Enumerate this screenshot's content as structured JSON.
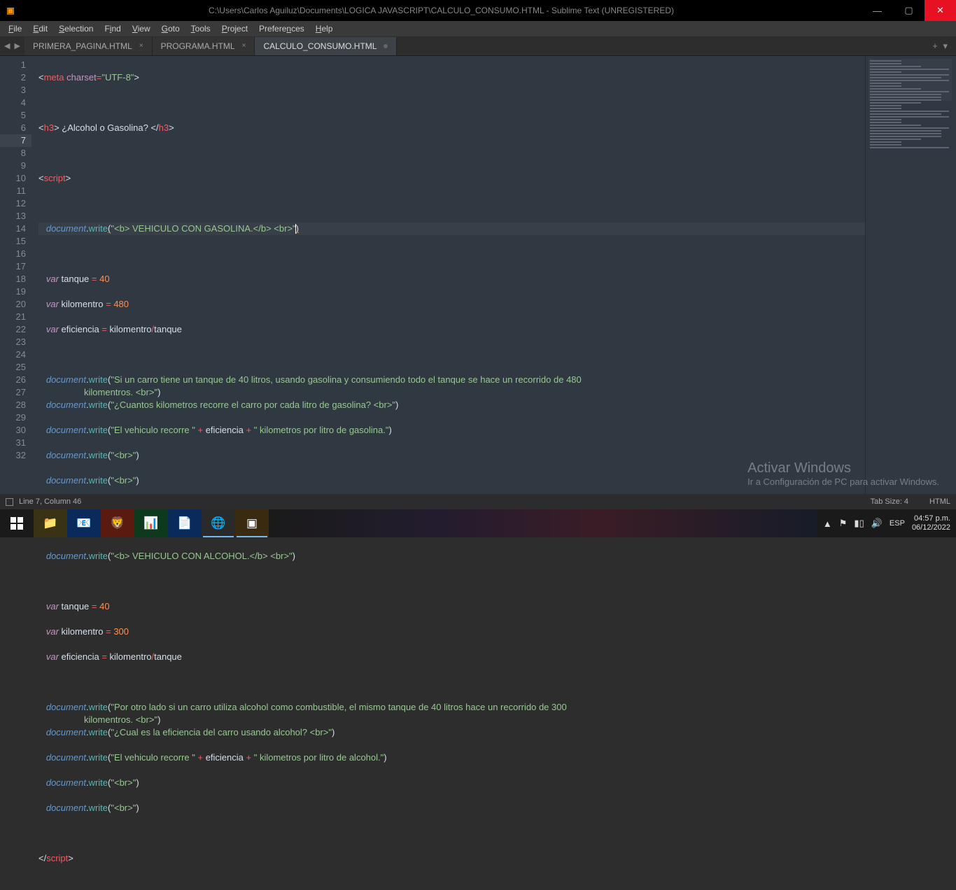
{
  "titlebar": {
    "path": "C:\\Users\\Carlos Aguiluz\\Documents\\LOGICA JAVASCRIPT\\CALCULO_CONSUMO.HTML - Sublime Text (UNREGISTERED)"
  },
  "menu": [
    "File",
    "Edit",
    "Selection",
    "Find",
    "View",
    "Goto",
    "Tools",
    "Project",
    "Preferences",
    "Help"
  ],
  "tabs": [
    {
      "label": "PRIMERA_PAGINA.HTML",
      "active": false
    },
    {
      "label": "PROGRAMA.HTML",
      "active": false
    },
    {
      "label": "CALCULO_CONSUMO.HTML",
      "active": true
    }
  ],
  "line_numbers": [
    "1",
    "2",
    "3",
    "4",
    "5",
    "6",
    "7",
    "8",
    "9",
    "10",
    "11",
    "12",
    "13",
    "14",
    "15",
    "16",
    "17",
    "18",
    "19",
    "20",
    "21",
    "22",
    "23",
    "24",
    "25",
    "26",
    "27",
    "28",
    "29",
    "30",
    "31",
    "32"
  ],
  "code": {
    "l1": {
      "pre": "<",
      "tag": "meta",
      "sp": " ",
      "attr": "charset",
      "eq": "=",
      "str": "\"UTF-8\"",
      "post": ">"
    },
    "l3": {
      "o1": "<",
      "t1": "h3",
      "c1": ">",
      "tx": " ¿Alcohol o Gasolina? ",
      "o2": "</",
      "t2": "h3",
      "c2": ">"
    },
    "l5": {
      "o": "<",
      "t": "script",
      "c": ">"
    },
    "l7": {
      "obj": "document",
      "dot": ".",
      "m": "write",
      "par": "(",
      "str": "\"<b> VEHICULO CON GASOLINA.</b> <br>\"",
      "par2": ")"
    },
    "l9": {
      "k": "var",
      "n": " tanque ",
      "eq": "=",
      "v": " 40"
    },
    "l10": {
      "k": "var",
      "n": " kilomentro ",
      "eq": "=",
      "v": " 480"
    },
    "l11": {
      "k": "var",
      "n": " eficiencia ",
      "eq": "=",
      "e": " kilomentro",
      "op": "/",
      "e2": "tanque"
    },
    "l13a": {
      "obj": "document",
      "dot": ".",
      "m": "write",
      "par": "(",
      "str": "\"Si un carro tiene un tanque de 40 litros, usando gasolina y consumiendo todo el tanque se hace un recorrido de 480 "
    },
    "l13b": {
      "str": "kilomentros. <br>\"",
      "par2": ")"
    },
    "l14": {
      "obj": "document",
      "dot": ".",
      "m": "write",
      "par": "(",
      "str": "\"¿Cuantos kilometros recorre el carro por cada litro de gasolina? <br>\"",
      "par2": ")"
    },
    "l15": {
      "obj": "document",
      "dot": ".",
      "m": "write",
      "par": "(",
      "s1": "\"El vehiculo recorre \"",
      "pl": " + ",
      "id": "eficiencia",
      "pl2": " + ",
      "s2": "\" kilometros por litro de gasolina.\"",
      "par2": ")"
    },
    "l16": {
      "obj": "document",
      "dot": ".",
      "m": "write",
      "par": "(",
      "str": "\"<br>\"",
      "par2": ")"
    },
    "l17": {
      "obj": "document",
      "dot": ".",
      "m": "write",
      "par": "(",
      "str": "\"<br>\"",
      "par2": ")"
    },
    "l20": {
      "obj": "document",
      "dot": ".",
      "m": "write",
      "par": "(",
      "str": "\"<b> VEHICULO CON ALCOHOL.</b> <br>\"",
      "par2": ")"
    },
    "l22": {
      "k": "var",
      "n": " tanque ",
      "eq": "=",
      "v": " 40"
    },
    "l23": {
      "k": "var",
      "n": " kilomentro ",
      "eq": "=",
      "v": " 300"
    },
    "l24": {
      "k": "var",
      "n": " eficiencia ",
      "eq": "=",
      "e": " kilomentro",
      "op": "/",
      "e2": "tanque"
    },
    "l26a": {
      "obj": "document",
      "dot": ".",
      "m": "write",
      "par": "(",
      "str": "\"Por otro lado si un carro utiliza alcohol como combustible, el mismo tanque de 40 litros hace un recorrido de 300 "
    },
    "l26b": {
      "str": "kilomentros. <br>\"",
      "par2": ")"
    },
    "l27": {
      "obj": "document",
      "dot": ".",
      "m": "write",
      "par": "(",
      "str": "\"¿Cual es la eficiencia del carro usando alcohol? <br>\"",
      "par2": ")"
    },
    "l28": {
      "obj": "document",
      "dot": ".",
      "m": "write",
      "par": "(",
      "s1": "\"El vehiculo recorre \"",
      "pl": " + ",
      "id": "eficiencia",
      "pl2": " + ",
      "s2": "\" kilometros por litro de alcohol.\"",
      "par2": ")"
    },
    "l29": {
      "obj": "document",
      "dot": ".",
      "m": "write",
      "par": "(",
      "str": "\"<br>\"",
      "par2": ")"
    },
    "l30": {
      "obj": "document",
      "dot": ".",
      "m": "write",
      "par": "(",
      "str": "\"<br>\"",
      "par2": ")"
    },
    "l32": {
      "o": "</",
      "t": "script",
      "c": ">"
    }
  },
  "status": {
    "pos": "Line 7, Column 46",
    "tabsize": "Tab Size: 4",
    "lang": "HTML"
  },
  "watermark": {
    "l1": "Activar Windows",
    "l2": "Ir a Configuración de PC para activar Windows."
  },
  "tray": {
    "lang": "ESP",
    "time": "04:57 p.m.",
    "date": "06/12/2022"
  }
}
